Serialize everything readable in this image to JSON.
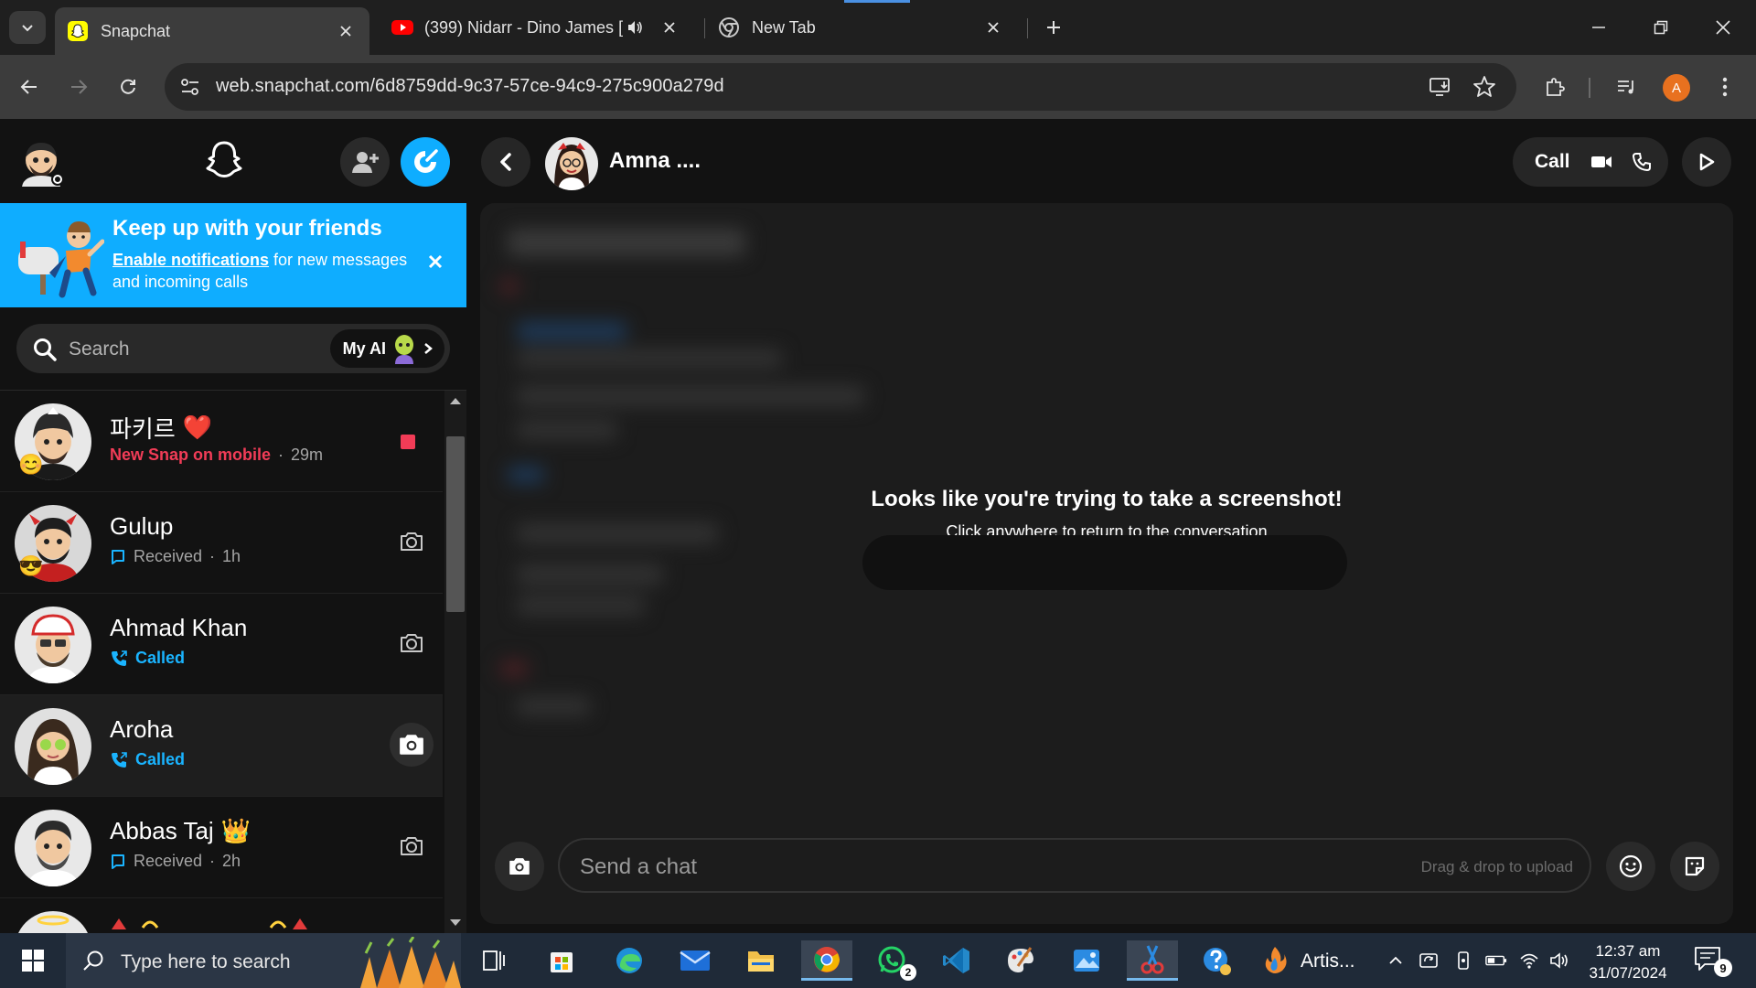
{
  "browser": {
    "tabs": [
      {
        "title": "Snapchat",
        "active": true
      },
      {
        "title": "(399) Nidarr - Dino James [",
        "active": false
      },
      {
        "title": "New Tab",
        "active": false
      }
    ],
    "url": "web.snapchat.com/6d8759dd-9c37-57ce-94c9-275c900a279d",
    "profile_initial": "A"
  },
  "sidebar": {
    "notification_banner": {
      "title": "Keep up with your friends",
      "link": "Enable notifications",
      "body": " for new messages and incoming calls"
    },
    "search": {
      "placeholder": "Search",
      "my_ai_label": "My AI"
    },
    "chats": [
      {
        "name": "파키르",
        "name_emoji": "❤️",
        "badge_emoji": "😊",
        "status": "New Snap on mobile",
        "time": "29m",
        "status_kind": "new-snap",
        "action": "new-snap"
      },
      {
        "name": "Gulup",
        "name_emoji": "",
        "badge_emoji": "😎",
        "status": "Received",
        "time": "1h",
        "status_kind": "received",
        "action": "camera"
      },
      {
        "name": "Ahmad Khan",
        "name_emoji": "",
        "badge_emoji": "",
        "status": "Called",
        "time": "",
        "status_kind": "called",
        "action": "camera"
      },
      {
        "name": "Aroha",
        "name_emoji": "",
        "badge_emoji": "",
        "status": "Called",
        "time": "",
        "status_kind": "called",
        "action": "camera-hover"
      },
      {
        "name": "Abbas Taj",
        "name_emoji": "👑",
        "badge_emoji": "",
        "status": "Received",
        "time": "2h",
        "status_kind": "received",
        "action": "camera"
      }
    ]
  },
  "conversation": {
    "contact_name": "Amna ....",
    "call_label": "Call",
    "screenshot_notice": {
      "title": "Looks like you're trying to take a screenshot!",
      "subtitle": "Click anywhere to return to the conversation"
    },
    "composer": {
      "placeholder": "Send a chat",
      "hint": "Drag & drop to upload"
    }
  },
  "taskbar": {
    "search_placeholder": "Type here to search",
    "whatsapp_badge": "2",
    "running_app_label": "Artis...",
    "time": "12:37 am",
    "date": "31/07/2024",
    "notification_count": "9"
  },
  "colors": {
    "snap_blue": "#0fadff",
    "snap_yellow": "#fffc00",
    "new_snap_red": "#f23c57",
    "called_blue": "#1ab4ff"
  }
}
